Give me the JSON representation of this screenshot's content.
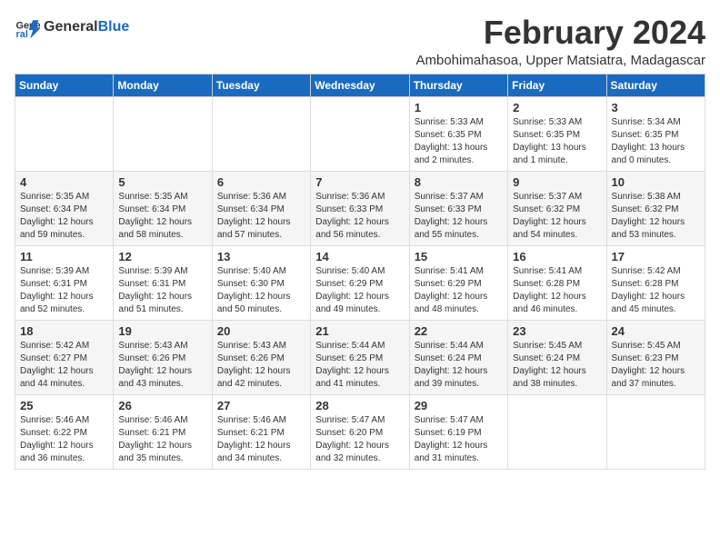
{
  "header": {
    "logo": {
      "text_general": "General",
      "text_blue": "Blue"
    },
    "month_title": "February 2024",
    "location": "Ambohimahasoa, Upper Matsiatra, Madagascar"
  },
  "calendar": {
    "days_of_week": [
      "Sunday",
      "Monday",
      "Tuesday",
      "Wednesday",
      "Thursday",
      "Friday",
      "Saturday"
    ],
    "weeks": [
      [
        {
          "day": "",
          "info": ""
        },
        {
          "day": "",
          "info": ""
        },
        {
          "day": "",
          "info": ""
        },
        {
          "day": "",
          "info": ""
        },
        {
          "day": "1",
          "info": "Sunrise: 5:33 AM\nSunset: 6:35 PM\nDaylight: 13 hours\nand 2 minutes."
        },
        {
          "day": "2",
          "info": "Sunrise: 5:33 AM\nSunset: 6:35 PM\nDaylight: 13 hours\nand 1 minute."
        },
        {
          "day": "3",
          "info": "Sunrise: 5:34 AM\nSunset: 6:35 PM\nDaylight: 13 hours\nand 0 minutes."
        }
      ],
      [
        {
          "day": "4",
          "info": "Sunrise: 5:35 AM\nSunset: 6:34 PM\nDaylight: 12 hours\nand 59 minutes."
        },
        {
          "day": "5",
          "info": "Sunrise: 5:35 AM\nSunset: 6:34 PM\nDaylight: 12 hours\nand 58 minutes."
        },
        {
          "day": "6",
          "info": "Sunrise: 5:36 AM\nSunset: 6:34 PM\nDaylight: 12 hours\nand 57 minutes."
        },
        {
          "day": "7",
          "info": "Sunrise: 5:36 AM\nSunset: 6:33 PM\nDaylight: 12 hours\nand 56 minutes."
        },
        {
          "day": "8",
          "info": "Sunrise: 5:37 AM\nSunset: 6:33 PM\nDaylight: 12 hours\nand 55 minutes."
        },
        {
          "day": "9",
          "info": "Sunrise: 5:37 AM\nSunset: 6:32 PM\nDaylight: 12 hours\nand 54 minutes."
        },
        {
          "day": "10",
          "info": "Sunrise: 5:38 AM\nSunset: 6:32 PM\nDaylight: 12 hours\nand 53 minutes."
        }
      ],
      [
        {
          "day": "11",
          "info": "Sunrise: 5:39 AM\nSunset: 6:31 PM\nDaylight: 12 hours\nand 52 minutes."
        },
        {
          "day": "12",
          "info": "Sunrise: 5:39 AM\nSunset: 6:31 PM\nDaylight: 12 hours\nand 51 minutes."
        },
        {
          "day": "13",
          "info": "Sunrise: 5:40 AM\nSunset: 6:30 PM\nDaylight: 12 hours\nand 50 minutes."
        },
        {
          "day": "14",
          "info": "Sunrise: 5:40 AM\nSunset: 6:29 PM\nDaylight: 12 hours\nand 49 minutes."
        },
        {
          "day": "15",
          "info": "Sunrise: 5:41 AM\nSunset: 6:29 PM\nDaylight: 12 hours\nand 48 minutes."
        },
        {
          "day": "16",
          "info": "Sunrise: 5:41 AM\nSunset: 6:28 PM\nDaylight: 12 hours\nand 46 minutes."
        },
        {
          "day": "17",
          "info": "Sunrise: 5:42 AM\nSunset: 6:28 PM\nDaylight: 12 hours\nand 45 minutes."
        }
      ],
      [
        {
          "day": "18",
          "info": "Sunrise: 5:42 AM\nSunset: 6:27 PM\nDaylight: 12 hours\nand 44 minutes."
        },
        {
          "day": "19",
          "info": "Sunrise: 5:43 AM\nSunset: 6:26 PM\nDaylight: 12 hours\nand 43 minutes."
        },
        {
          "day": "20",
          "info": "Sunrise: 5:43 AM\nSunset: 6:26 PM\nDaylight: 12 hours\nand 42 minutes."
        },
        {
          "day": "21",
          "info": "Sunrise: 5:44 AM\nSunset: 6:25 PM\nDaylight: 12 hours\nand 41 minutes."
        },
        {
          "day": "22",
          "info": "Sunrise: 5:44 AM\nSunset: 6:24 PM\nDaylight: 12 hours\nand 39 minutes."
        },
        {
          "day": "23",
          "info": "Sunrise: 5:45 AM\nSunset: 6:24 PM\nDaylight: 12 hours\nand 38 minutes."
        },
        {
          "day": "24",
          "info": "Sunrise: 5:45 AM\nSunset: 6:23 PM\nDaylight: 12 hours\nand 37 minutes."
        }
      ],
      [
        {
          "day": "25",
          "info": "Sunrise: 5:46 AM\nSunset: 6:22 PM\nDaylight: 12 hours\nand 36 minutes."
        },
        {
          "day": "26",
          "info": "Sunrise: 5:46 AM\nSunset: 6:21 PM\nDaylight: 12 hours\nand 35 minutes."
        },
        {
          "day": "27",
          "info": "Sunrise: 5:46 AM\nSunset: 6:21 PM\nDaylight: 12 hours\nand 34 minutes."
        },
        {
          "day": "28",
          "info": "Sunrise: 5:47 AM\nSunset: 6:20 PM\nDaylight: 12 hours\nand 32 minutes."
        },
        {
          "day": "29",
          "info": "Sunrise: 5:47 AM\nSunset: 6:19 PM\nDaylight: 12 hours\nand 31 minutes."
        },
        {
          "day": "",
          "info": ""
        },
        {
          "day": "",
          "info": ""
        }
      ]
    ]
  }
}
